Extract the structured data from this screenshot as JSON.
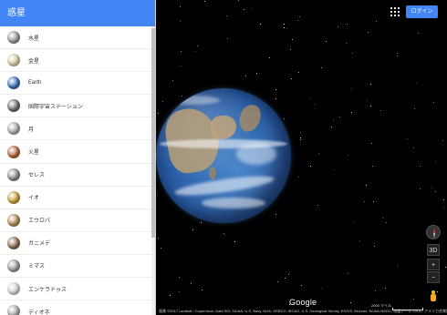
{
  "sidebar": {
    "title": "惑星",
    "items": [
      {
        "label": "水星",
        "color": "#9a9a9a"
      },
      {
        "label": "金星",
        "color": "#d9cfa6"
      },
      {
        "label": "Earth",
        "color": "#3b6fb8"
      },
      {
        "label": "国際宇宙ステーション",
        "color": "#6d6d6d"
      },
      {
        "label": "月",
        "color": "#aaaaaa"
      },
      {
        "label": "火星",
        "color": "#b5653c"
      },
      {
        "label": "セレス",
        "color": "#8a8a8a"
      },
      {
        "label": "イオ",
        "color": "#c8a23a"
      },
      {
        "label": "エウロパ",
        "color": "#b08a5a"
      },
      {
        "label": "ガニメデ",
        "color": "#8a6a52"
      },
      {
        "label": "ミマス",
        "color": "#9b9b9b"
      },
      {
        "label": "エンケラドゥス",
        "color": "#cfd6db"
      },
      {
        "label": "ディオネ",
        "color": "#a8a8a8"
      }
    ]
  },
  "language": {
    "value": "あ"
  },
  "collapse": {
    "glyph": "◀"
  },
  "header": {
    "login_label": "ログイン"
  },
  "map": {
    "logo": "Google",
    "attribution": "画像 ©2017 Landsat / Copernicus, Data SIO, NOAA, U.S. Navy, NGA, GEBCO, IBCAO, U.S. Geological Survey, ESG/S, Brunner, NOAA-NGDC, 地図データ ©2017 アメリカ合衆国 利用規約 Google マップに問題を報告",
    "scale_label": "2000 マイル",
    "controls": {
      "tilt": "3D",
      "zoom_in": "+",
      "zoom_out": "−"
    }
  },
  "colors": {
    "accent": "#4285f4"
  }
}
